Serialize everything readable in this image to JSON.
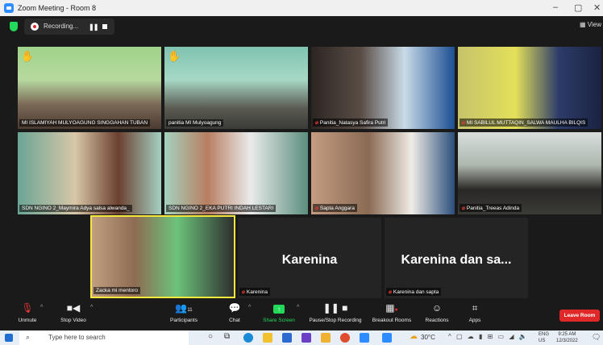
{
  "window": {
    "title": "Zoom Meeting - Room 8",
    "view_label": "View"
  },
  "recording": {
    "label": "Recording..."
  },
  "tiles": [
    {
      "name": "MI ISLAMIYAH MULYOAGUNG SINGGAHAN TUBAN",
      "muted": false,
      "hand": true
    },
    {
      "name": "panitia MI Mulyoagung",
      "muted": false,
      "hand": true
    },
    {
      "name": "Panitia_Natasya Safira Putri",
      "muted": true,
      "hand": false
    },
    {
      "name": "MI SABILUL MUTTAQIN_SALWA MAULHA BILQIS",
      "muted": true,
      "hand": false
    },
    {
      "name": "SDN NGINO 2_Maymira Adya salsa alwanda_",
      "muted": false,
      "hand": false
    },
    {
      "name": "SDN NGINO 2_EKA PUTRI INDAH LESTARI",
      "muted": false,
      "hand": false
    },
    {
      "name": "Sapta Anggara",
      "muted": true,
      "hand": false
    },
    {
      "name": "Panitia_Treeas Adinda",
      "muted": true,
      "hand": false
    },
    {
      "name": "Zacka mi mentoro",
      "muted": false,
      "hand": false
    },
    {
      "name": "Karenina",
      "muted": true,
      "hand": false,
      "big": "Karenina"
    },
    {
      "name": "Karenina dan sapta",
      "muted": true,
      "hand": false,
      "big": "Karenina dan sa..."
    }
  ],
  "toolbar": {
    "unmute": "Unmute",
    "stop_video": "Stop Video",
    "participants": "Participants",
    "participants_count": "11",
    "chat": "Chat",
    "share_screen": "Share Screen",
    "record": "Pause/Stop Recording",
    "breakout": "Breakout Rooms",
    "reactions": "Reactions",
    "apps": "Apps",
    "leave": "Leave Room"
  },
  "taskbar": {
    "search_placeholder": "Type here to search",
    "weather": "30°C",
    "lang": "ENG",
    "region": "US",
    "time": "9:25 AM",
    "date": "12/3/2022"
  },
  "colors": {
    "accent": "#2d8cff",
    "leave": "#e02828",
    "share": "#23d959",
    "active_speaker": "#f7e83b"
  }
}
